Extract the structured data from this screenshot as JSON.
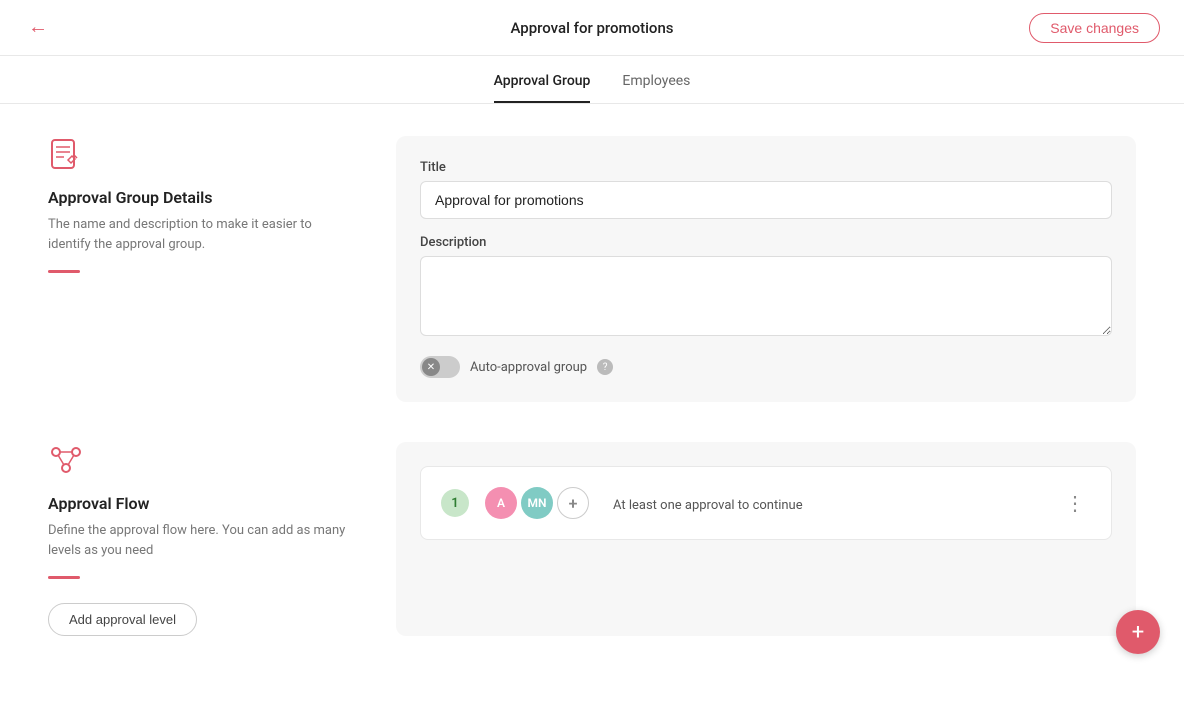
{
  "header": {
    "title": "Approval for promotions",
    "save_label": "Save changes"
  },
  "tabs": [
    {
      "id": "approval-group",
      "label": "Approval Group",
      "active": true
    },
    {
      "id": "employees",
      "label": "Employees",
      "active": false
    }
  ],
  "details_section": {
    "title": "Approval Group Details",
    "description": "The name and description to make it easier to identify the approval group.",
    "form": {
      "title_label": "Title",
      "title_value": "Approval for promotions",
      "title_placeholder": "",
      "description_label": "Description",
      "description_value": "",
      "description_placeholder": "",
      "auto_approval_label": "Auto-approval group",
      "toggle_state": "off"
    }
  },
  "flow_section": {
    "title": "Approval Flow",
    "description": "Define the approval flow here. You can add as many levels as you need",
    "flow_card": {
      "level": "1",
      "approvers": [
        {
          "initials": "A",
          "color": "pink"
        },
        {
          "initials": "MN",
          "color": "teal"
        }
      ],
      "text": "At least one approval to continue"
    },
    "add_level_label": "Add approval level"
  },
  "icons": {
    "back": "←",
    "more_vert": "⋮",
    "plus": "+",
    "help": "?",
    "toggle_x": "✕"
  },
  "colors": {
    "accent": "#e05a6b",
    "green_badge": "#c8e6c9",
    "avatar_pink": "#f48fb1",
    "avatar_teal": "#80cbc4"
  }
}
